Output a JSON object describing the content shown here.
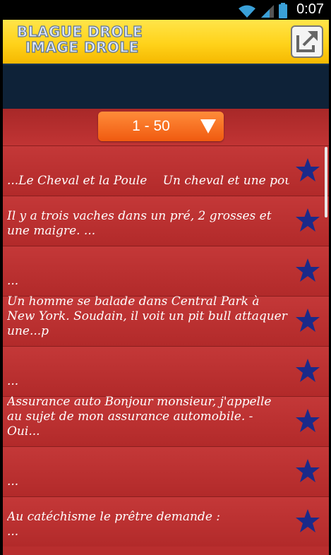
{
  "status": {
    "time": "0:07",
    "icons": [
      "wifi-icon",
      "signal-icon",
      "battery-icon"
    ]
  },
  "app": {
    "logo_line1": "BLAGUE DROLE",
    "logo_line2": "IMAGE DROLE",
    "share_icon": "share-icon"
  },
  "pager": {
    "label": "1 - 50",
    "arrow_icon": "dropdown-arrow-icon"
  },
  "rows": [
    {
      "text": "...Le Cheval et la Poule  Un cheval et une poule",
      "favorite_icon": "star-icon"
    },
    {
      "text": "Il y a trois vaches dans un pré, 2 grosses et une maigre. ...",
      "favorite_icon": "star-icon"
    },
    {
      "text": "...",
      "favorite_icon": "star-icon"
    },
    {
      "text": "Un homme se balade dans Central Park à New York. Soudain, il voit un pit bull attaquer une...p",
      "favorite_icon": "star-icon"
    },
    {
      "text": "...",
      "favorite_icon": "star-icon"
    },
    {
      "text": "Assurance auto Bonjour monsieur, j'appelle au sujet de mon assurance automobile. - Oui...",
      "favorite_icon": "star-icon"
    },
    {
      "text": "...",
      "favorite_icon": "star-icon"
    },
    {
      "text": "Au catéchisme le prêtre demande :\n...",
      "favorite_icon": "star-icon"
    }
  ],
  "colors": {
    "list_bg": "#b82e2e",
    "pager": "#f06a1a",
    "appbar": "#ffd21a",
    "star": "#1a2a8a"
  }
}
